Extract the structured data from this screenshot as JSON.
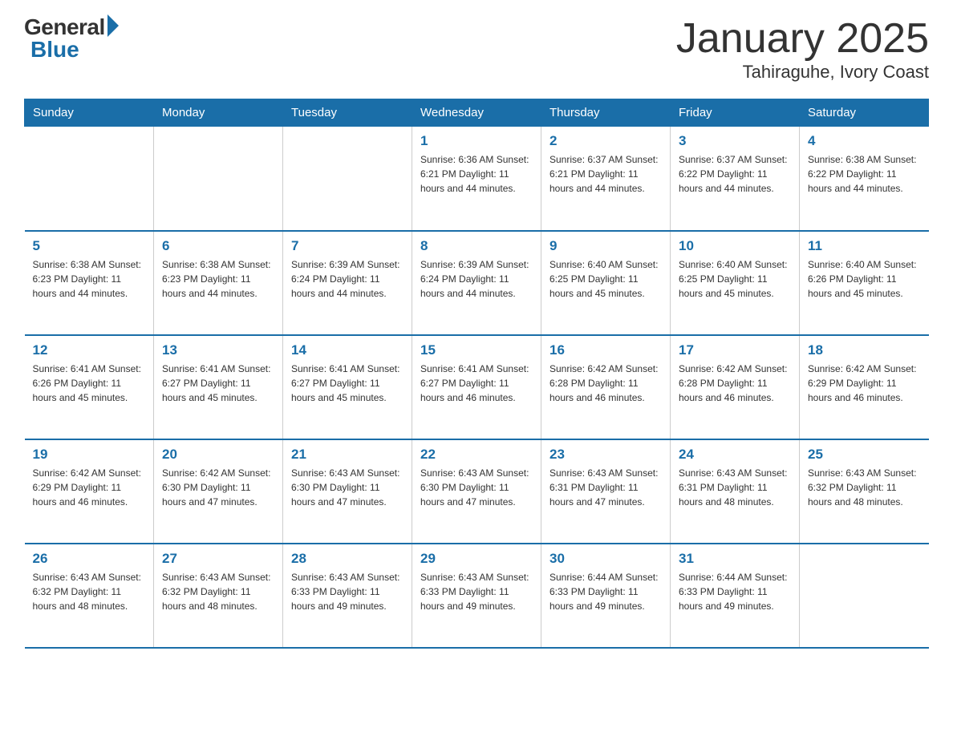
{
  "logo": {
    "general": "General",
    "blue": "Blue"
  },
  "title": "January 2025",
  "subtitle": "Tahiraguhe, Ivory Coast",
  "days_of_week": [
    "Sunday",
    "Monday",
    "Tuesday",
    "Wednesday",
    "Thursday",
    "Friday",
    "Saturday"
  ],
  "weeks": [
    [
      {
        "num": "",
        "info": ""
      },
      {
        "num": "",
        "info": ""
      },
      {
        "num": "",
        "info": ""
      },
      {
        "num": "1",
        "info": "Sunrise: 6:36 AM\nSunset: 6:21 PM\nDaylight: 11 hours and 44 minutes."
      },
      {
        "num": "2",
        "info": "Sunrise: 6:37 AM\nSunset: 6:21 PM\nDaylight: 11 hours and 44 minutes."
      },
      {
        "num": "3",
        "info": "Sunrise: 6:37 AM\nSunset: 6:22 PM\nDaylight: 11 hours and 44 minutes."
      },
      {
        "num": "4",
        "info": "Sunrise: 6:38 AM\nSunset: 6:22 PM\nDaylight: 11 hours and 44 minutes."
      }
    ],
    [
      {
        "num": "5",
        "info": "Sunrise: 6:38 AM\nSunset: 6:23 PM\nDaylight: 11 hours and 44 minutes."
      },
      {
        "num": "6",
        "info": "Sunrise: 6:38 AM\nSunset: 6:23 PM\nDaylight: 11 hours and 44 minutes."
      },
      {
        "num": "7",
        "info": "Sunrise: 6:39 AM\nSunset: 6:24 PM\nDaylight: 11 hours and 44 minutes."
      },
      {
        "num": "8",
        "info": "Sunrise: 6:39 AM\nSunset: 6:24 PM\nDaylight: 11 hours and 44 minutes."
      },
      {
        "num": "9",
        "info": "Sunrise: 6:40 AM\nSunset: 6:25 PM\nDaylight: 11 hours and 45 minutes."
      },
      {
        "num": "10",
        "info": "Sunrise: 6:40 AM\nSunset: 6:25 PM\nDaylight: 11 hours and 45 minutes."
      },
      {
        "num": "11",
        "info": "Sunrise: 6:40 AM\nSunset: 6:26 PM\nDaylight: 11 hours and 45 minutes."
      }
    ],
    [
      {
        "num": "12",
        "info": "Sunrise: 6:41 AM\nSunset: 6:26 PM\nDaylight: 11 hours and 45 minutes."
      },
      {
        "num": "13",
        "info": "Sunrise: 6:41 AM\nSunset: 6:27 PM\nDaylight: 11 hours and 45 minutes."
      },
      {
        "num": "14",
        "info": "Sunrise: 6:41 AM\nSunset: 6:27 PM\nDaylight: 11 hours and 45 minutes."
      },
      {
        "num": "15",
        "info": "Sunrise: 6:41 AM\nSunset: 6:27 PM\nDaylight: 11 hours and 46 minutes."
      },
      {
        "num": "16",
        "info": "Sunrise: 6:42 AM\nSunset: 6:28 PM\nDaylight: 11 hours and 46 minutes."
      },
      {
        "num": "17",
        "info": "Sunrise: 6:42 AM\nSunset: 6:28 PM\nDaylight: 11 hours and 46 minutes."
      },
      {
        "num": "18",
        "info": "Sunrise: 6:42 AM\nSunset: 6:29 PM\nDaylight: 11 hours and 46 minutes."
      }
    ],
    [
      {
        "num": "19",
        "info": "Sunrise: 6:42 AM\nSunset: 6:29 PM\nDaylight: 11 hours and 46 minutes."
      },
      {
        "num": "20",
        "info": "Sunrise: 6:42 AM\nSunset: 6:30 PM\nDaylight: 11 hours and 47 minutes."
      },
      {
        "num": "21",
        "info": "Sunrise: 6:43 AM\nSunset: 6:30 PM\nDaylight: 11 hours and 47 minutes."
      },
      {
        "num": "22",
        "info": "Sunrise: 6:43 AM\nSunset: 6:30 PM\nDaylight: 11 hours and 47 minutes."
      },
      {
        "num": "23",
        "info": "Sunrise: 6:43 AM\nSunset: 6:31 PM\nDaylight: 11 hours and 47 minutes."
      },
      {
        "num": "24",
        "info": "Sunrise: 6:43 AM\nSunset: 6:31 PM\nDaylight: 11 hours and 48 minutes."
      },
      {
        "num": "25",
        "info": "Sunrise: 6:43 AM\nSunset: 6:32 PM\nDaylight: 11 hours and 48 minutes."
      }
    ],
    [
      {
        "num": "26",
        "info": "Sunrise: 6:43 AM\nSunset: 6:32 PM\nDaylight: 11 hours and 48 minutes."
      },
      {
        "num": "27",
        "info": "Sunrise: 6:43 AM\nSunset: 6:32 PM\nDaylight: 11 hours and 48 minutes."
      },
      {
        "num": "28",
        "info": "Sunrise: 6:43 AM\nSunset: 6:33 PM\nDaylight: 11 hours and 49 minutes."
      },
      {
        "num": "29",
        "info": "Sunrise: 6:43 AM\nSunset: 6:33 PM\nDaylight: 11 hours and 49 minutes."
      },
      {
        "num": "30",
        "info": "Sunrise: 6:44 AM\nSunset: 6:33 PM\nDaylight: 11 hours and 49 minutes."
      },
      {
        "num": "31",
        "info": "Sunrise: 6:44 AM\nSunset: 6:33 PM\nDaylight: 11 hours and 49 minutes."
      },
      {
        "num": "",
        "info": ""
      }
    ]
  ]
}
